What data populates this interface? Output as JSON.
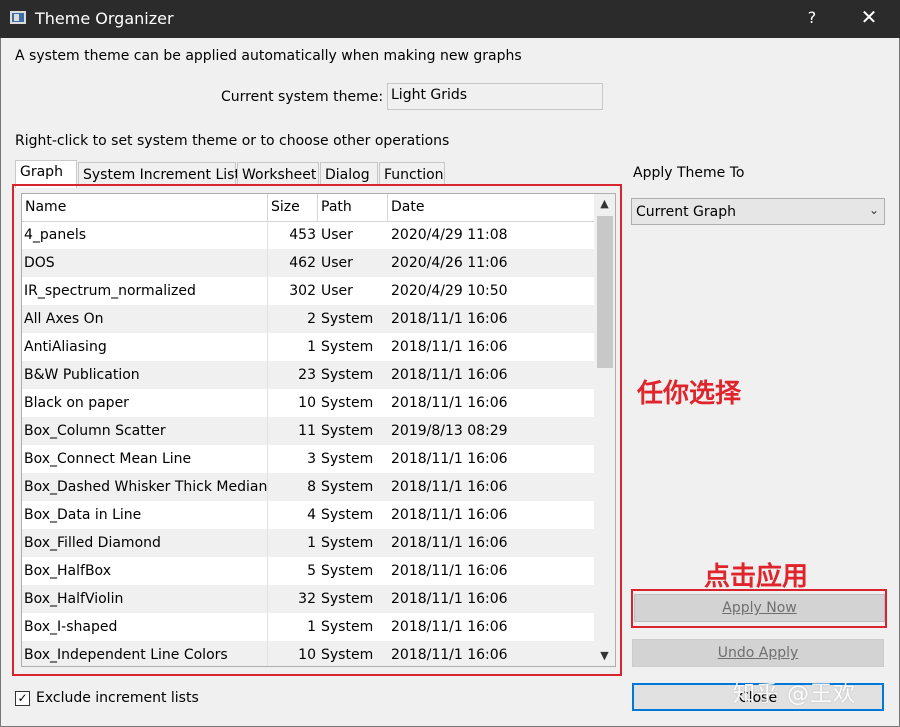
{
  "window": {
    "title": "Theme Organizer",
    "help_glyph": "?",
    "close_glyph": "✕"
  },
  "info_text": "A system theme can be applied automatically when making new graphs",
  "current_theme": {
    "label": "Current system theme:",
    "value": "Light Grids"
  },
  "instruction": "Right-click to set system theme or to choose other operations",
  "tabs": [
    {
      "label": "Graph",
      "active": true
    },
    {
      "label": "System Increment Lists",
      "active": false
    },
    {
      "label": "Worksheet",
      "active": false
    },
    {
      "label": "Dialog",
      "active": false
    },
    {
      "label": "Function",
      "active": false
    }
  ],
  "table": {
    "columns": [
      "Name",
      "Size",
      "Path",
      "Date"
    ],
    "rows": [
      {
        "name": "4_panels",
        "size": "453",
        "path": "User",
        "date": "2020/4/29 11:08"
      },
      {
        "name": "DOS",
        "size": "462",
        "path": "User",
        "date": "2020/4/26 11:06"
      },
      {
        "name": "IR_spectrum_normalized",
        "size": "302",
        "path": "User",
        "date": "2020/4/29 10:50"
      },
      {
        "name": "All Axes On",
        "size": "2",
        "path": "System",
        "date": "2018/11/1 16:06"
      },
      {
        "name": "AntiAliasing",
        "size": "1",
        "path": "System",
        "date": "2018/11/1 16:06"
      },
      {
        "name": "B&W Publication",
        "size": "23",
        "path": "System",
        "date": "2018/11/1 16:06"
      },
      {
        "name": "Black on paper",
        "size": "10",
        "path": "System",
        "date": "2018/11/1 16:06"
      },
      {
        "name": "Box_Column Scatter",
        "size": "11",
        "path": "System",
        "date": "2019/8/13 08:29"
      },
      {
        "name": "Box_Connect Mean Line",
        "size": "3",
        "path": "System",
        "date": "2018/11/1 16:06"
      },
      {
        "name": "Box_Dashed Whisker Thick Median",
        "size": "8",
        "path": "System",
        "date": "2018/11/1 16:06"
      },
      {
        "name": "Box_Data in Line",
        "size": "4",
        "path": "System",
        "date": "2018/11/1 16:06"
      },
      {
        "name": "Box_Filled Diamond",
        "size": "1",
        "path": "System",
        "date": "2018/11/1 16:06"
      },
      {
        "name": "Box_HalfBox",
        "size": "5",
        "path": "System",
        "date": "2018/11/1 16:06"
      },
      {
        "name": "Box_HalfViolin",
        "size": "32",
        "path": "System",
        "date": "2018/11/1 16:06"
      },
      {
        "name": "Box_I-shaped",
        "size": "1",
        "path": "System",
        "date": "2018/11/1 16:06"
      },
      {
        "name": "Box_Independent Line Colors",
        "size": "10",
        "path": "System",
        "date": "2018/11/1 16:06"
      }
    ]
  },
  "apply_theme_to": {
    "label": "Apply Theme To",
    "selected": "Current Graph"
  },
  "buttons": {
    "apply_now": "Apply Now",
    "undo_apply": "Undo Apply",
    "close": "Close"
  },
  "exclude_checkbox": {
    "label": "Exclude increment lists",
    "checked": true,
    "mark": "✓"
  },
  "annotations": {
    "choose": "任你选择",
    "click_apply": "点击应用"
  },
  "watermark": "知乎 @王欢",
  "colors": {
    "annotation_red": "#d9232d",
    "titlebar": "#2b2b2b",
    "focus_blue": "#0078d7"
  }
}
